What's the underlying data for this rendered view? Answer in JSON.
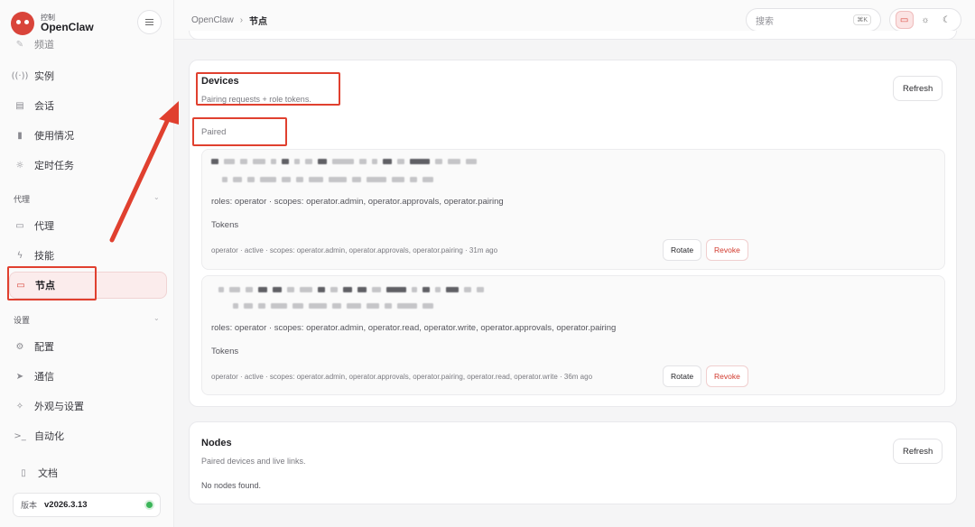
{
  "brand": {
    "sub": "控制",
    "name": "OpenClaw"
  },
  "nav": {
    "partial_item": "频道",
    "top_items": [
      {
        "label": "实例",
        "icon": "broadcast-icon"
      },
      {
        "label": "会话",
        "icon": "document-icon"
      },
      {
        "label": "使用情况",
        "icon": "bar-chart-icon"
      },
      {
        "label": "定时任务",
        "icon": "sun-clock-icon"
      }
    ],
    "group_agent": "代理",
    "agent_items": [
      {
        "label": "代理",
        "icon": "folder-icon"
      },
      {
        "label": "技能",
        "icon": "lightning-icon"
      },
      {
        "label": "节点",
        "icon": "monitor-icon"
      }
    ],
    "group_settings": "设置",
    "settings_items": [
      {
        "label": "配置",
        "icon": "gear-icon"
      },
      {
        "label": "通信",
        "icon": "send-icon"
      },
      {
        "label": "外观与设置",
        "icon": "sparkle-icon"
      },
      {
        "label": "自动化",
        "icon": "terminal-icon"
      }
    ],
    "docs": "文档"
  },
  "version": {
    "label": "版本",
    "value": "v2026.3.13",
    "status_color": "#3bb559"
  },
  "topbar": {
    "breadcrumb_root": "OpenClaw",
    "breadcrumb_current": "节点",
    "search_placeholder": "搜索",
    "search_shortcut": "⌘K"
  },
  "devices": {
    "title": "Devices",
    "subtitle": "Pairing requests + role tokens.",
    "refresh": "Refresh",
    "paired_label": "Paired",
    "items": [
      {
        "roles": "roles: operator · scopes: operator.admin, operator.approvals, operator.pairing",
        "tokens_label": "Tokens",
        "meta": "operator · active · scopes: operator.admin, operator.approvals, operator.pairing · 31m ago",
        "rotate": "Rotate",
        "revoke": "Revoke"
      },
      {
        "roles": "roles: operator · scopes: operator.admin, operator.read, operator.write, operator.approvals, operator.pairing",
        "tokens_label": "Tokens",
        "meta": "operator · active · scopes: operator.admin, operator.approvals, operator.pairing, operator.read, operator.write · 36m ago",
        "rotate": "Rotate",
        "revoke": "Revoke"
      }
    ]
  },
  "nodes": {
    "title": "Nodes",
    "subtitle": "Paired devices and live links.",
    "refresh": "Refresh",
    "empty": "No nodes found."
  },
  "colors": {
    "accent": "#d9443a",
    "annotation": "#e0402f"
  }
}
